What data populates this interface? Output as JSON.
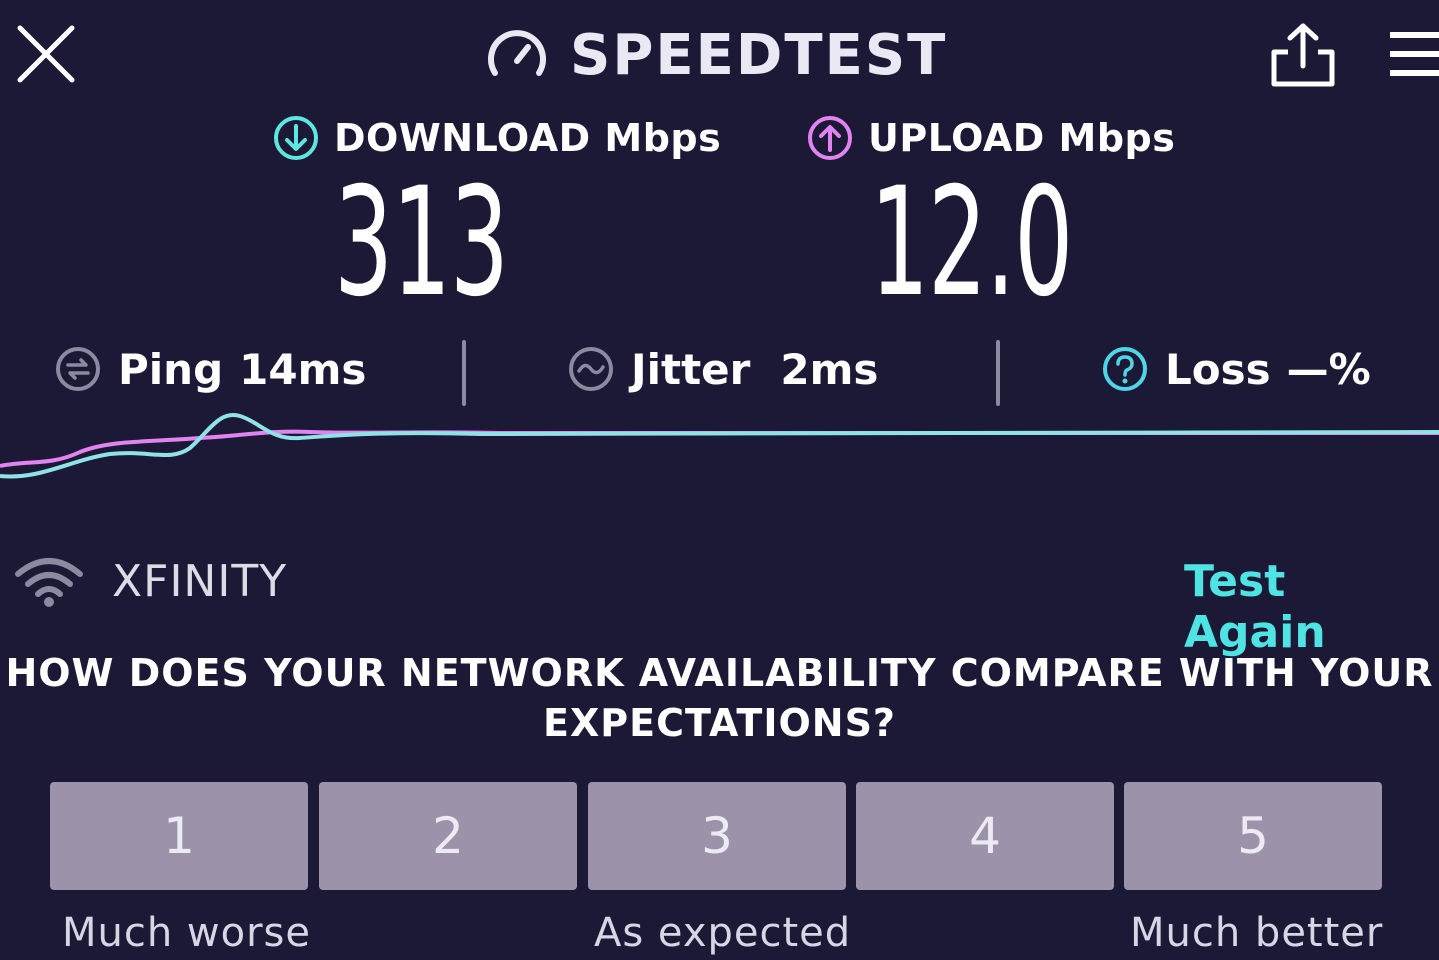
{
  "header": {
    "title": "SPEEDTEST",
    "close_icon": "close-icon",
    "share_icon": "share-icon",
    "menu_icon": "hamburger-menu-icon"
  },
  "download": {
    "label": "DOWNLOAD Mbps",
    "value": "313",
    "color": "#5ee6e0"
  },
  "upload": {
    "label": "UPLOAD Mbps",
    "value": "12.0",
    "color": "#e184f0"
  },
  "stats": {
    "ping": {
      "label": "Ping",
      "value": "14ms"
    },
    "jitter": {
      "label": "Jitter",
      "value": "2ms"
    },
    "loss": {
      "label": "Loss",
      "value": "—%"
    }
  },
  "network": {
    "name": "XFINITY",
    "action": "Test Again"
  },
  "survey": {
    "question": "HOW DOES YOUR NETWORK AVAILABILITY COMPARE WITH YOUR EXPECTATIONS?",
    "ratings": [
      "1",
      "2",
      "3",
      "4",
      "5"
    ],
    "scale_labels": {
      "low": "Much worse",
      "mid": "As expected",
      "high": "Much better"
    }
  },
  "colors": {
    "background": "#1b1935",
    "accent": "#4fe3e3",
    "button": "#9c93aa"
  }
}
